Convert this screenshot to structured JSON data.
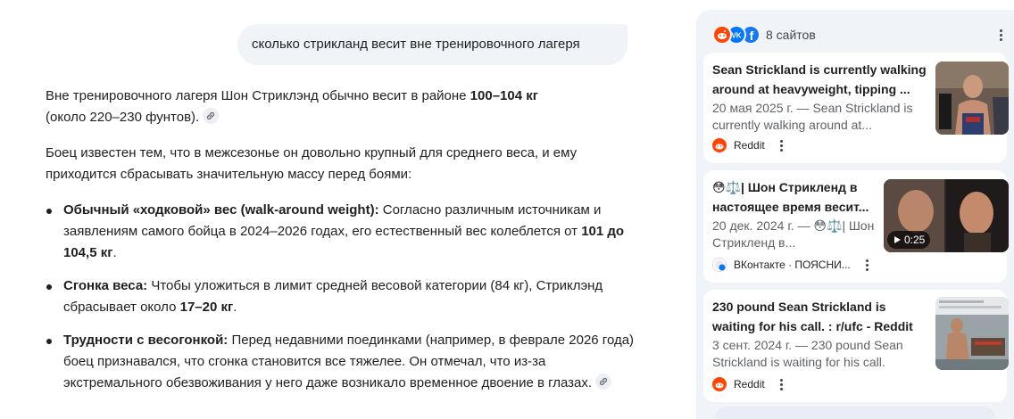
{
  "query": "сколько стрикланд весит вне тренировочного лагеря",
  "answer": {
    "p1_a": "Вне тренировочного лагеря Шон Стриклэнд обычно весит в районе ",
    "p1_b": "100–104 кг",
    "p1_c": "(около 220–230 фунтов).",
    "p2": "Боец известен тем, что в межсезонье он довольно крупный для среднего веса, и ему приходится сбрасывать значительную массу перед боями:",
    "items": [
      {
        "title": "Обычный «ходковой» вес (walk-around weight):",
        "text_a": " Согласно различным источникам и заявлениям самого бойца в 2024–2026 годах, его естественный вес колеблется от ",
        "bold": "101 до 104,5 кг",
        "text_b": "."
      },
      {
        "title": "Сгонка веса:",
        "text_a": " Чтобы уложиться в лимит средней весовой категории (84 кг), Стриклэнд сбрасывает около ",
        "bold": "17–20 кг",
        "text_b": "."
      },
      {
        "title": "Трудности с весогонкой:",
        "text_a": " Перед недавними поединками (например, в феврале 2026 года) боец признавался, что сгонка становится все тяжелее. Он отмечал, что из-за экстремального обезвоживания у него даже возникало временное двоение в глазах."
      }
    ]
  },
  "sources": {
    "count_label": "8 сайтов",
    "cards": [
      {
        "title": "Sean Strickland is currently walking around at heavyweight, tipping ...",
        "snippet": "20 мая 2025 г. — Sean Strickland is currently walking around at...",
        "source_name": "Reddit"
      },
      {
        "title": "😳⚖️| Шон Стрикленд в настоящее время весит...",
        "snippet": "20 дек. 2024 г. — 😳⚖️| Шон Стрикленд в...",
        "source_name": "ВКонтакте · ПОЯСНИ...",
        "video_duration": "0:25"
      },
      {
        "title": "230 pound Sean Strickland is waiting for his call. : r/ufc - Reddit",
        "snippet": "3 сент. 2024 г. — 230 pound Sean Strickland is waiting for his call.",
        "source_name": "Reddit"
      }
    ]
  },
  "colors": {
    "panel_bg": "#f0f4f9",
    "reddit": "#ff4500",
    "vk": "#0077ff",
    "facebook": "#1877f2"
  }
}
